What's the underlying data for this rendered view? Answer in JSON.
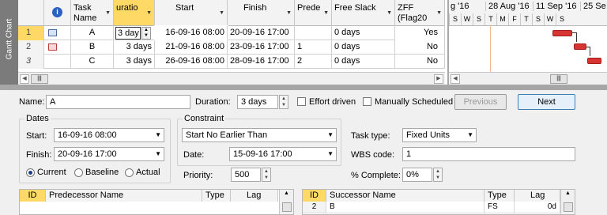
{
  "side_label": "Gantt Chart",
  "columns": [
    "Task Name",
    "uratio",
    "Start",
    "Finish",
    "Prede",
    "Free Slack",
    "ZFF (Flag20"
  ],
  "rows": [
    {
      "num": "1",
      "name": "A",
      "duration": "3 day",
      "start": "16-09-16 08:00",
      "finish": "20-09-16 17:00",
      "pred": "",
      "slack": "0 days",
      "zff": "Yes"
    },
    {
      "num": "2",
      "name": "B",
      "duration": "3 days",
      "start": "21-09-16 08:00",
      "finish": "23-09-16 17:00",
      "pred": "1",
      "slack": "0 days",
      "zff": "No"
    },
    {
      "num": "3",
      "name": "C",
      "duration": "3 days",
      "start": "26-09-16 08:00",
      "finish": "28-09-16 17:00",
      "pred": "2",
      "slack": "0 days",
      "zff": "No"
    }
  ],
  "timescale": {
    "weeks": [
      "g '16",
      "28 Aug '16",
      "11 Sep '16",
      "25 Se"
    ],
    "days": [
      "S",
      "W",
      "S",
      "T",
      "M",
      "F",
      "T",
      "S",
      "W",
      "S"
    ]
  },
  "form": {
    "name_label": "Name:",
    "name": "A",
    "duration_label": "Duration:",
    "duration": "3 days",
    "effort_driven": "Effort driven",
    "manually_scheduled": "Manually Scheduled",
    "previous": "Previous",
    "next": "Next",
    "dates_title": "Dates",
    "start_label": "Start:",
    "start": "16-09-16 08:00",
    "finish_label": "Finish:",
    "finish": "20-09-16 17:00",
    "current": "Current",
    "baseline": "Baseline",
    "actual": "Actual",
    "constraint_title": "Constraint",
    "constraint_type": "Start No Earlier Than",
    "date_label": "Date:",
    "constraint_date": "15-09-16 17:00",
    "priority_label": "Priority:",
    "priority": "500",
    "task_type_label": "Task type:",
    "task_type": "Fixed Units",
    "wbs_label": "WBS code:",
    "wbs": "1",
    "pct_label": "% Complete:",
    "pct": "0%"
  },
  "pred_table": {
    "headers": [
      "ID",
      "Predecessor Name",
      "Type",
      "Lag"
    ]
  },
  "succ_table": {
    "headers": [
      "ID",
      "Successor Name",
      "Type",
      "Lag"
    ],
    "rows": [
      {
        "id": "2",
        "name": "B",
        "type": "FS",
        "lag": "0d"
      }
    ]
  }
}
